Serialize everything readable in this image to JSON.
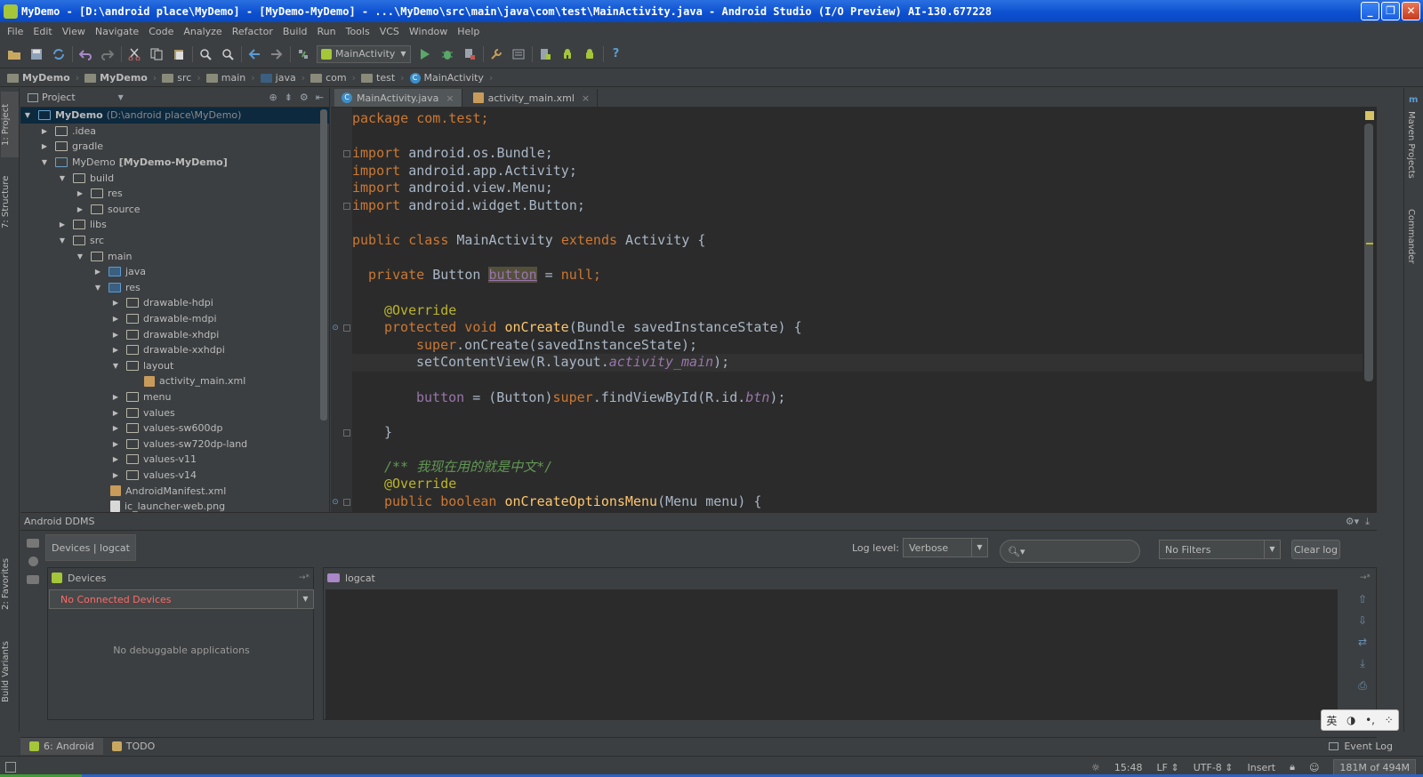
{
  "window": {
    "title": "MyDemo - [D:\\android place\\MyDemo] - [MyDemo-MyDemo] - ...\\MyDemo\\src\\main\\java\\com\\test\\MainActivity.java - Android Studio (I/O Preview) AI-130.677228",
    "buttons": {
      "minimize": "_",
      "maximize": "❐",
      "close": "✕"
    }
  },
  "menu": [
    "File",
    "Edit",
    "View",
    "Navigate",
    "Code",
    "Analyze",
    "Refactor",
    "Build",
    "Run",
    "Tools",
    "VCS",
    "Window",
    "Help"
  ],
  "toolbar": {
    "run_config": "MainActivity",
    "help": "?"
  },
  "breadcrumb": [
    "MyDemo",
    "MyDemo",
    "src",
    "main",
    "java",
    "com",
    "test",
    "MainActivity"
  ],
  "left_stripe": {
    "project_tab": "1: Project",
    "structure_tab": "7: Structure",
    "favorites_tab": "2: Favorites",
    "build_variants_tab": "Build Variants"
  },
  "right_stripe": {
    "maven_tab": "Maven Projects",
    "commander_tab": "Commander",
    "maven_icon": "m"
  },
  "project_panel": {
    "title": "Project",
    "tree": [
      {
        "label": "MyDemo",
        "extra": "(D:\\android place\\MyDemo)"
      },
      {
        "label": ".idea"
      },
      {
        "label": "gradle"
      },
      {
        "label": "MyDemo",
        "extra": "[MyDemo-MyDemo]"
      },
      {
        "label": "build"
      },
      {
        "label": "res"
      },
      {
        "label": "source"
      },
      {
        "label": "libs"
      },
      {
        "label": "src"
      },
      {
        "label": "main"
      },
      {
        "label": "java"
      },
      {
        "label": "res"
      },
      {
        "label": "drawable-hdpi"
      },
      {
        "label": "drawable-mdpi"
      },
      {
        "label": "drawable-xhdpi"
      },
      {
        "label": "drawable-xxhdpi"
      },
      {
        "label": "layout"
      },
      {
        "label": "activity_main.xml"
      },
      {
        "label": "menu"
      },
      {
        "label": "values"
      },
      {
        "label": "values-sw600dp"
      },
      {
        "label": "values-sw720dp-land"
      },
      {
        "label": "values-v11"
      },
      {
        "label": "values-v14"
      },
      {
        "label": "AndroidManifest.xml"
      },
      {
        "label": "ic_launcher-web.png"
      }
    ]
  },
  "editor": {
    "tabs": [
      {
        "label": "MainActivity.java",
        "close": "×"
      },
      {
        "label": "activity_main.xml",
        "close": "×"
      }
    ],
    "code": {
      "l1": "package com.test;",
      "l3_kw": "import",
      "l3": " android.os.Bundle;",
      "l4_kw": "import",
      "l4": " android.app.Activity;",
      "l5_kw": "import",
      "l5": " android.view.Menu;",
      "l6_kw": "import",
      "l6": " android.widget.Button;",
      "l8_kw": "public class",
      "l8_name": " MainActivity ",
      "l8_kw2": "extends",
      "l8_rest": " Activity {",
      "l10_kw": "private",
      "l10_type": " Button ",
      "l10_var": "button",
      "l10_eq": " = ",
      "l10_null": "null",
      "l10_end": ";",
      "l12": "@Override",
      "l13_kw": "protected void",
      "l13_fn": "onCreate",
      "l13_rest": "(Bundle savedInstanceState) {",
      "l14_kw": "super",
      "l14_rest": ".onCreate(savedInstanceState);",
      "l15_a": "setContentView(R.layout.",
      "l15_it": "activity_main",
      "l15_b": ");",
      "l17_fld": "button",
      "l17_a": " = (Button)",
      "l17_kw": "super",
      "l17_b": ".findViewById(R.id.",
      "l17_it": "btn",
      "l17_c": ");",
      "l19": "}",
      "l21": "/** 我现在用的就是中文*/",
      "l22": "@Override",
      "l23_kw": "public boolean",
      "l23_fn": "onCreateOptionsMenu",
      "l23_rest": "(Menu menu) {"
    }
  },
  "ddms": {
    "title": "Android DDMS",
    "subtab": "Devices | logcat",
    "log_level_label": "Log level:",
    "log_level_value": "Verbose",
    "filter_value": "No Filters",
    "clear_log": "Clear log",
    "devices_title": "Devices",
    "device_select": "No Connected Devices",
    "no_apps": "No debuggable applications",
    "logcat_title": "logcat"
  },
  "ime": {
    "lang": "英"
  },
  "bottom_tabs": {
    "android": "6: Android",
    "todo": "TODO",
    "event_log": "Event Log"
  },
  "status": {
    "position": "15:48",
    "line_sep": "LF",
    "encoding": "UTF-8",
    "mode": "Insert",
    "memory": "181M of 494M"
  },
  "colors": {
    "keyword": "#cc7832",
    "annotation": "#bbb529",
    "method": "#ffc66d",
    "field": "#9876aa",
    "comment": "#629755",
    "error_text": "#ff6b68"
  }
}
